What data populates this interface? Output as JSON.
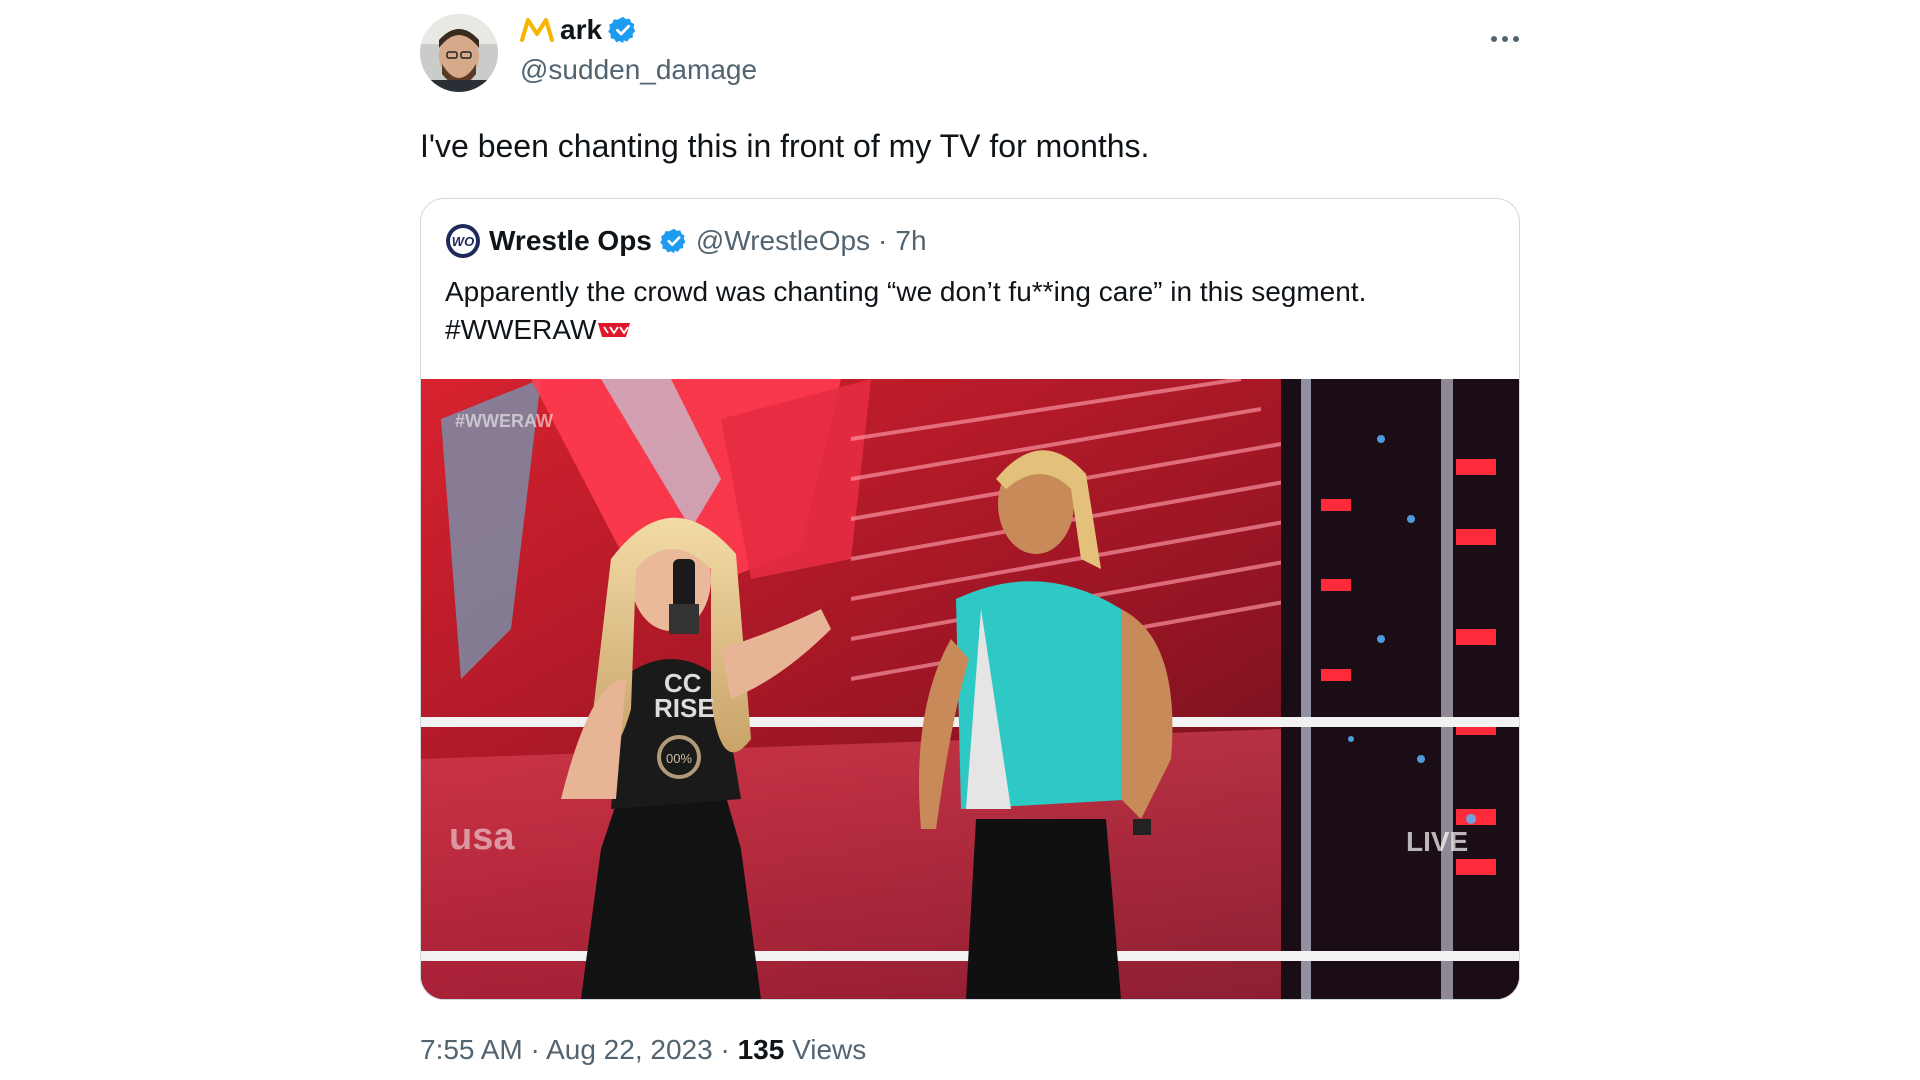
{
  "author": {
    "name": "ark",
    "handle": "@sudden_damage"
  },
  "tweet": {
    "text": "I've been chanting this in front of my TV for months."
  },
  "quote": {
    "name": "Wrestle Ops",
    "handle": "@WrestleOps",
    "separator": "·",
    "age": "7h",
    "text_line1": "Apparently the crowd was chanting “we don’t fu**ing care” in this segment.",
    "hashtag": "#WWERAW",
    "media": {
      "watermark": "#WWERAW",
      "network_logo": "usa",
      "live_bug": "LIVE",
      "shirt_text_1": "CC",
      "shirt_text_2": "RISE",
      "belt_text": "00%"
    }
  },
  "meta": {
    "time": "7:55 AM",
    "dot1": "·",
    "date": "Aug 22, 2023",
    "dot2": "·",
    "views": "135",
    "views_label": "Views"
  },
  "colors": {
    "verified": "#1d9bf0",
    "text": "#0f1419",
    "secondary": "#536471",
    "border": "#cfd9de",
    "logo_m": "#f4b400"
  },
  "icons": {
    "verified": "verified-badge-icon",
    "more": "more-horizontal-icon"
  }
}
